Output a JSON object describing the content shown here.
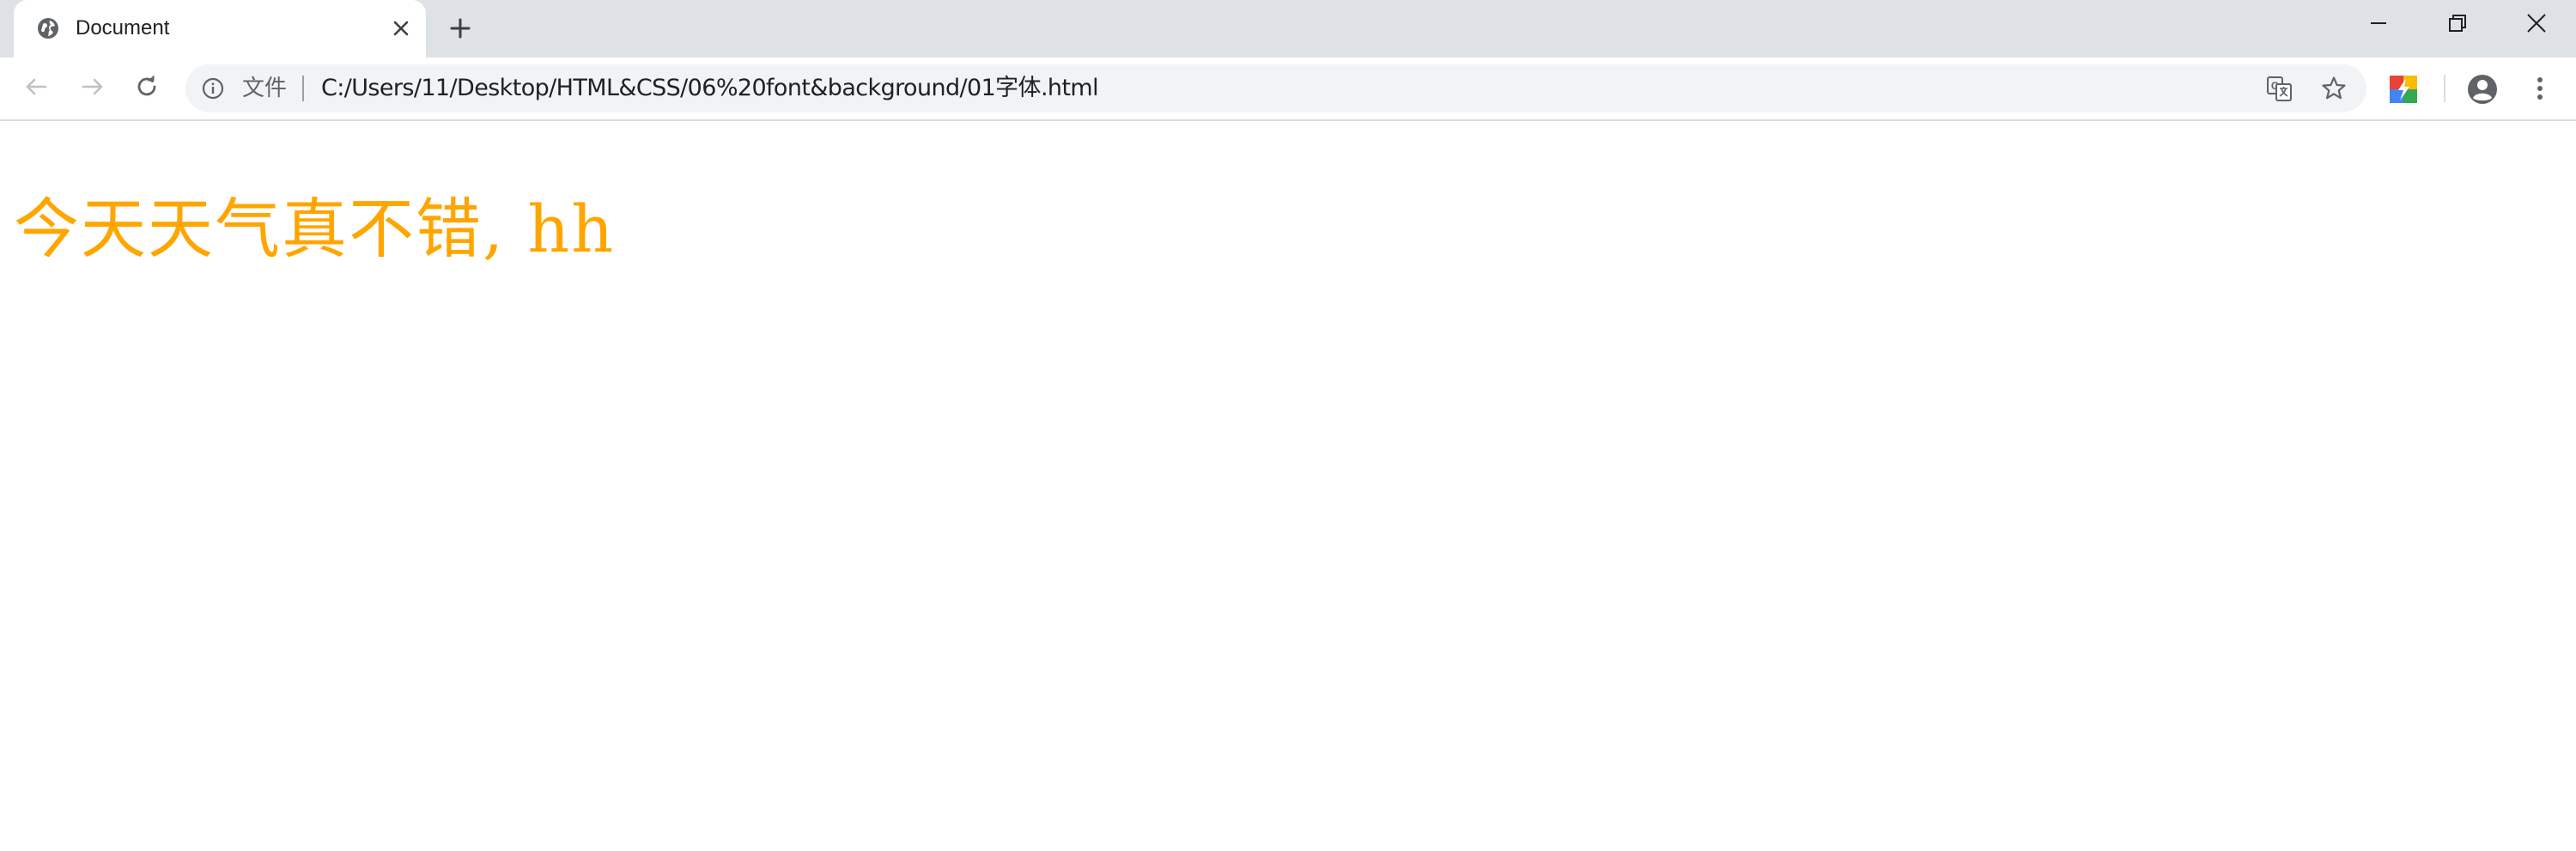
{
  "tab": {
    "title": "Document",
    "favicon_icon": "globe-icon",
    "close_icon": "close-icon"
  },
  "new_tab_icon": "plus-icon",
  "window_controls": {
    "minimize_icon": "minimize-icon",
    "restore_icon": "restore-icon",
    "close_icon": "close-icon"
  },
  "toolbar": {
    "back_icon": "arrow-left-icon",
    "forward_icon": "arrow-right-icon",
    "reload_icon": "reload-icon",
    "security_icon": "info-icon",
    "security_label": "文件",
    "url": "C:/Users/11/Desktop/HTML&CSS/06%20font&background/01字体.html",
    "translate_icon": "translate-icon",
    "bookmark_icon": "star-icon",
    "extension_icon": "extension-icon",
    "profile_icon": "account-icon",
    "menu_icon": "more-vertical-icon"
  },
  "page": {
    "text": "今天天气真不错, hh",
    "text_color": "#ffa500"
  },
  "colors": {
    "tabstrip": "#dee1e6",
    "omnibox": "#f1f3f4",
    "icon": "#5f6368"
  }
}
